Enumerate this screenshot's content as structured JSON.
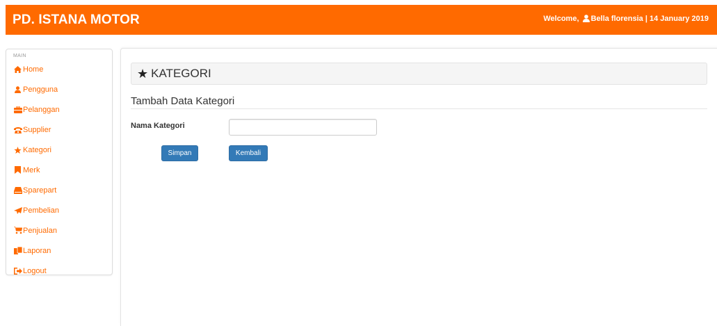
{
  "header": {
    "brand": "PD. ISTANA MOTOR",
    "welcome_prefix": "Welcome,",
    "user_name": "Bella florensia",
    "separator": "|",
    "date": "14 January 2019",
    "bg_color": "#ff6a00"
  },
  "sidebar": {
    "section_label": "MAIN",
    "items": [
      {
        "label": "Home",
        "icon": "home-icon"
      },
      {
        "label": "Pengguna",
        "icon": "user-icon"
      },
      {
        "label": "Pelanggan",
        "icon": "briefcase-icon"
      },
      {
        "label": "Supplier",
        "icon": "phone-icon"
      },
      {
        "label": "Kategori",
        "icon": "star-icon"
      },
      {
        "label": "Merk",
        "icon": "bookmark-icon"
      },
      {
        "label": "Sparepart",
        "icon": "inbox-icon"
      },
      {
        "label": "Pembelian",
        "icon": "send-icon"
      },
      {
        "label": "Penjualan",
        "icon": "cart-icon"
      },
      {
        "label": "Laporan",
        "icon": "documents-icon"
      },
      {
        "label": "Logout",
        "icon": "logout-icon"
      }
    ],
    "accent_color": "#ff6a00"
  },
  "main": {
    "heading": "KATEGORI",
    "heading_icon": "star-icon",
    "subheading": "Tambah Data Kategori",
    "form": {
      "field_label": "Nama Kategori",
      "field_value": "",
      "field_placeholder": "",
      "save_label": "Simpan",
      "back_label": "Kembali"
    },
    "button_color": "#337ab7"
  }
}
